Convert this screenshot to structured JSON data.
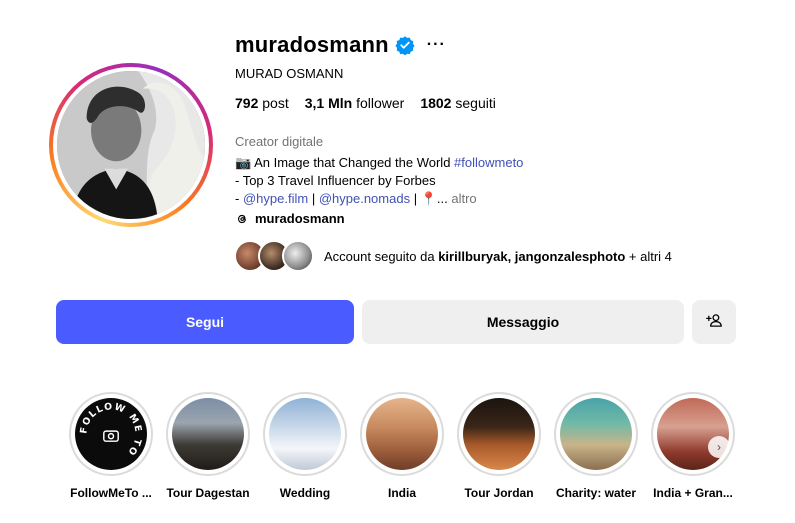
{
  "profile": {
    "username": "muradosmann",
    "full_name": "MURAD OSMANN",
    "more_label": "···",
    "stats": {
      "posts_value": "792",
      "posts_label": "post",
      "followers_value": "3,1 Mln",
      "followers_label": "follower",
      "following_value": "1802",
      "following_label": "seguiti"
    },
    "category": "Creator digitale",
    "bio": {
      "line1_emoji": "📷",
      "line1_text": "An Image that Changed the World",
      "line1_hashtag": "#followmeto",
      "line2": "- Top 3 Travel Influencer by Forbes",
      "line3_prefix": "-",
      "line3_link1": "@hype.film",
      "line3_sep1": "|",
      "line3_link2": "@hype.nomads",
      "line3_sep2": "|",
      "line3_pin": "📍",
      "line3_ellipsis": "...",
      "line3_more": "altro"
    },
    "threads_handle": "muradosmann",
    "followed_by": {
      "prefix": "Account seguito da",
      "users": "kirillburyak, jangonzalesphoto",
      "suffix": "+ altri 4"
    }
  },
  "actions": {
    "follow_label": "Segui",
    "message_label": "Messaggio",
    "add_user_icon": "person-add-icon"
  },
  "highlights": [
    {
      "label": "FollowMeTo ..."
    },
    {
      "label": "Tour Dagestan"
    },
    {
      "label": "Wedding"
    },
    {
      "label": "India"
    },
    {
      "label": "Tour Jordan"
    },
    {
      "label": "Charity: water"
    },
    {
      "label": "India + Gran..."
    }
  ],
  "highlight_badge_text": "FOLLOW ME TO",
  "colors": {
    "follow_button": "#4a5cff",
    "secondary_button": "#efefef",
    "link": "#3f51b5",
    "muted_text": "#737373",
    "verified_badge": "#0095f6"
  }
}
